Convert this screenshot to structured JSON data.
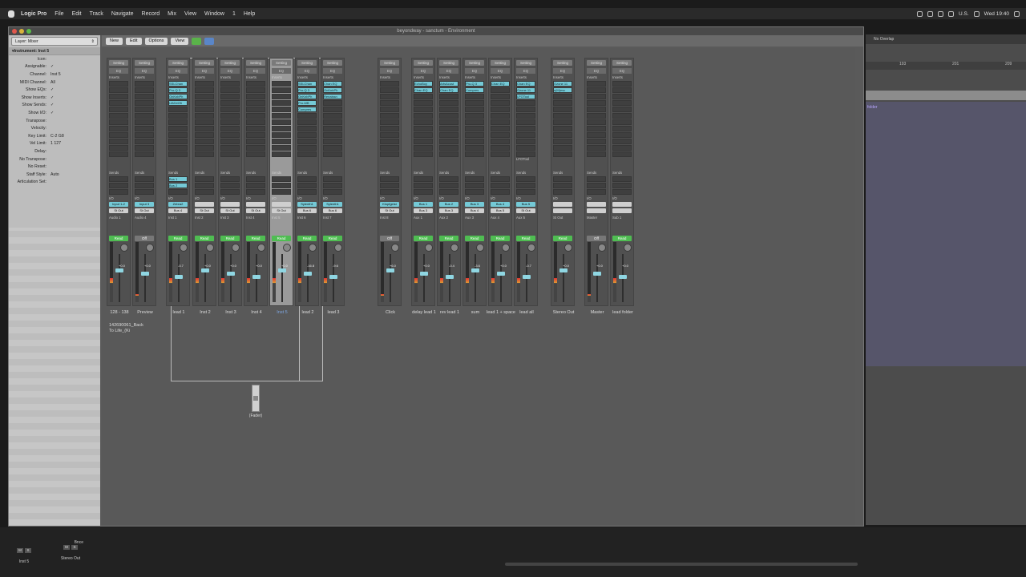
{
  "menubar": {
    "app": "Logic Pro",
    "items": [
      "File",
      "Edit",
      "Track",
      "Navigate",
      "Record",
      "Mix",
      "View",
      "Window",
      "1",
      "Help"
    ],
    "status": [
      "U.S.",
      "Wed 19:40"
    ]
  },
  "window": {
    "title": "beyondway - sanctum - Environment",
    "ghost_title": "beyondway - sanctum - Tracks"
  },
  "toolbar": {
    "new": "New",
    "edit": "Edit",
    "options": "Options",
    "view": "View"
  },
  "inspector": {
    "layer_label": "Layer:",
    "layer_value": "Mixer",
    "section": "Instrument: Inst 5",
    "rows": [
      {
        "k": "Icon:",
        "v": ""
      },
      {
        "k": "Assignable:",
        "v": "✓"
      },
      {
        "k": "Channel:",
        "v": "Inst 5"
      },
      {
        "k": "MIDI Channel:",
        "v": "All"
      },
      {
        "k": "Show EQs:",
        "v": "✓"
      },
      {
        "k": "Show Inserts:",
        "v": "✓"
      },
      {
        "k": "Show Sends:",
        "v": "✓"
      },
      {
        "k": "Show I/O:",
        "v": "✓"
      },
      {
        "k": "Transpose:",
        "v": ""
      },
      {
        "k": "Velocity:",
        "v": ""
      },
      {
        "k": "Key Limit:",
        "v": "C-2  G8"
      },
      {
        "k": "Vel Limit:",
        "v": "1  127"
      },
      {
        "k": "Delay:",
        "v": ""
      },
      {
        "k": "No Transpose:",
        "v": ""
      },
      {
        "k": "No Reset:",
        "v": ""
      },
      {
        "k": "Staff Style:",
        "v": "Auto"
      },
      {
        "k": "Articulation Set:",
        "v": ""
      }
    ]
  },
  "strip_labels": {
    "setting": "Setting",
    "eq": "EQ",
    "inserts": "Inserts",
    "sends": "Sends",
    "io": "I/O"
  },
  "strips": [
    {
      "name": "128 - 138",
      "extra": "142690061_Back To Life_(Ki",
      "inserts": [],
      "sends": [],
      "in": "Input 1-2",
      "out": "St Out",
      "sub": "Audio 1",
      "auto": "Read",
      "vol": "+0.0"
    },
    {
      "name": "Preview",
      "inserts": [],
      "sends": [],
      "in": "Input 3",
      "out": "St Out",
      "sub": "Audio 4",
      "auto": "Off",
      "vol": "+0.0"
    },
    {
      "name": "lead 1",
      "inserts": [
        "SSLChan",
        "Pro-Q 3",
        "OnKnbPh",
        "UADel26"
      ],
      "sends": [
        "Bus 1",
        "Bus 2"
      ],
      "in": "Zebra2",
      "out": "Bus 4",
      "sub": "Inst 1",
      "auto": "Read",
      "vol": "-0.7"
    },
    {
      "name": "Inst 2",
      "inserts": [],
      "sends": [],
      "in": "",
      "out": "St Out",
      "sub": "Inst 2",
      "auto": "Read",
      "vol": "+0.0"
    },
    {
      "name": "Inst 3",
      "inserts": [],
      "sends": [],
      "in": "",
      "out": "St Out",
      "sub": "Inst 3",
      "auto": "Read",
      "vol": "+0.0"
    },
    {
      "name": "Inst 4",
      "inserts": [],
      "sends": [],
      "in": "",
      "out": "St Out",
      "sub": "Inst 4",
      "auto": "Read",
      "vol": "+0.0"
    },
    {
      "name": "Inst 5",
      "inserts": [],
      "sends": [],
      "in": "",
      "out": "St Out",
      "sub": "Inst 5",
      "auto": "Read",
      "vol": "+0.0",
      "selected": true
    },
    {
      "name": "lead 2",
      "inserts": [
        "SSLChan",
        "Pro-Q 3",
        "OnKnbPh",
        "Pro-MB",
        "Compres"
      ],
      "sends": [],
      "in": "Sylenth1",
      "out": "Bus 6",
      "sub": "Inst 6",
      "auto": "Read",
      "vol": "-16.8"
    },
    {
      "name": "lead 3",
      "inserts": [
        "Chan EQ",
        "OnKnbPh",
        "Renaissn"
      ],
      "sends": [],
      "in": "Sylenth1",
      "out": "Bus 6",
      "sub": "Inst 7",
      "auto": "Read",
      "vol": "-9.6",
      "eqcurve": true
    },
    {
      "name": "Click",
      "inserts": [],
      "sends": [],
      "in": "Klopfgeist",
      "out": "St Out",
      "sub": "Inst 8",
      "auto": "Off",
      "vol": "+6.0"
    },
    {
      "name": "delay lead 1",
      "inserts": [
        "EchoBoy",
        "Chan EQ"
      ],
      "sends": [],
      "in": "Bus 1",
      "out": "Bus 3",
      "sub": "Aux 1",
      "auto": "Read",
      "vol": "+0.0",
      "eqcurve": true
    },
    {
      "name": "rev lead 1",
      "inserts": [
        "ArtsAcust",
        "Chan EQ"
      ],
      "sends": [],
      "in": "Bus 2",
      "out": "Bus 3",
      "sub": "Aux 2",
      "auto": "Read",
      "vol": "-0.4",
      "eqcurve": true
    },
    {
      "name": "sum",
      "inserts": [
        "Pro-Q 3",
        "Compres"
      ],
      "sends": [],
      "in": "Bus 3",
      "out": "Bus 4",
      "sub": "Aux 3",
      "auto": "Read",
      "vol": "-3.6"
    },
    {
      "name": "lead 1 + space",
      "inserts": [
        "Chan EQ"
      ],
      "sends": [],
      "in": "Bus 4",
      "out": "Bus 5",
      "sub": "Aux 4",
      "auto": "Read",
      "vol": "+0.0",
      "eqcurve": true
    },
    {
      "name": "lead all",
      "inserts": [
        "Chan EQ",
        "Ozone 11",
        "LFOTool"
      ],
      "sends": [],
      "in": "Bus 5",
      "out": "St Out",
      "sub": "Aux 5",
      "auto": "Read",
      "vol": "-0.7",
      "eqcurve": true,
      "note": "LFOTool"
    },
    {
      "name": "Stereo Out",
      "inserts": [
        "Ozone 11",
        "s(M)esc"
      ],
      "sends": [],
      "in": "",
      "out": "",
      "sub": "St Out",
      "auto": "Read",
      "vol": "+0.0"
    },
    {
      "name": "Master",
      "inserts": [],
      "sends": [],
      "in": "",
      "out": "",
      "sub": "Master",
      "auto": "Off",
      "vol": "+0.0"
    },
    {
      "name": "lead folder",
      "inserts": [],
      "sends": [],
      "in": "",
      "out": "",
      "sub": "Sub 1",
      "auto": "Read",
      "vol": "+0.0"
    }
  ],
  "drag_fader": {
    "label": "(Fader)"
  },
  "arrange": {
    "overlap": "No Overlap",
    "ruler": [
      "193",
      "201",
      "209"
    ],
    "region": "folder"
  },
  "bottom": {
    "strips": [
      {
        "name": "Inst 5"
      },
      {
        "name": "Stereo Out",
        "extra": "Bnce"
      }
    ],
    "m": "M",
    "s": "S"
  },
  "colors": {
    "plugin": "#74c9d6",
    "read": "#4fbd52",
    "selected_name": "#7ea6e0"
  }
}
